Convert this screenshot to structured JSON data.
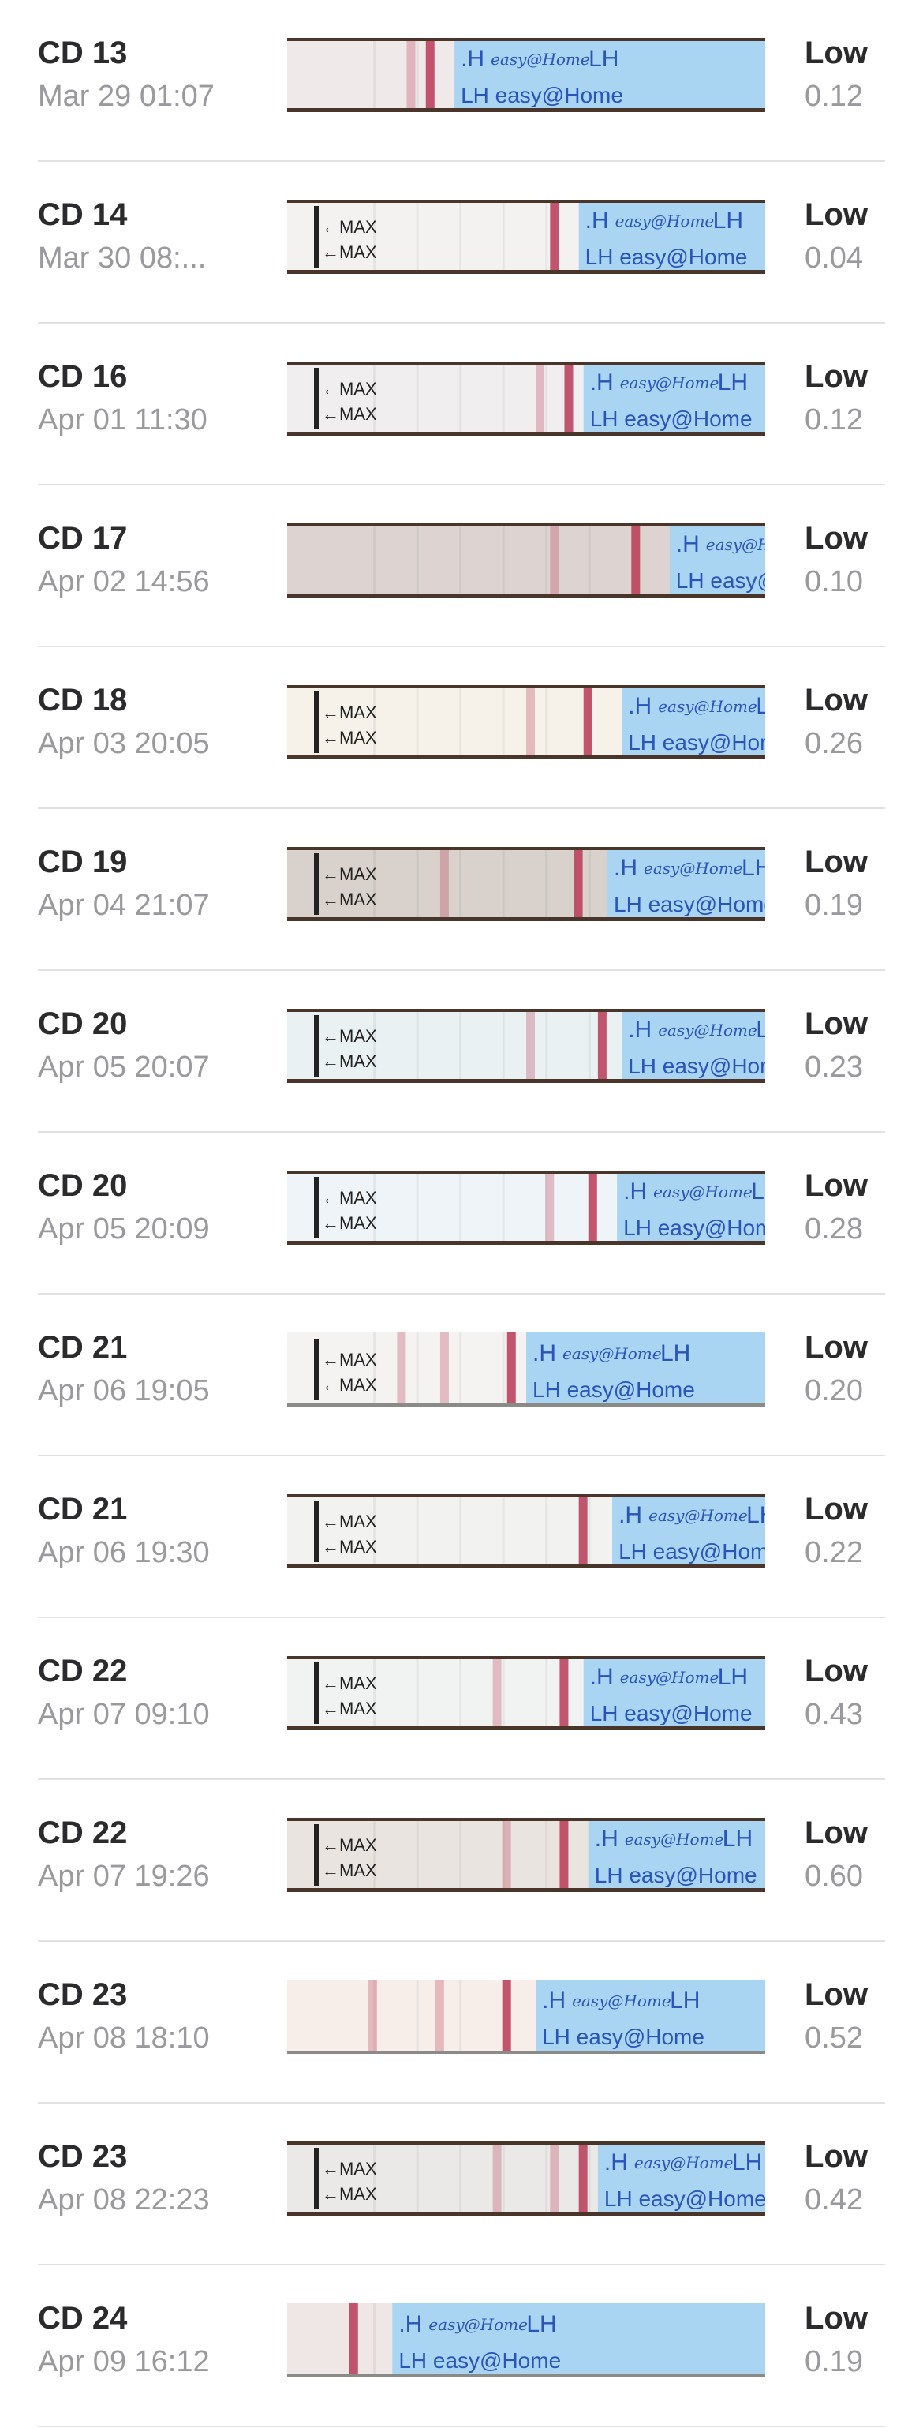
{
  "brand_text": "easy@Home",
  "lh_text": "LH",
  "max_text": "MAX",
  "colors": {
    "strip_blue": "#a9d4f2",
    "strip_text": "#2a55b8",
    "test_line": "#b93a56",
    "tape_brown": "#4a352a",
    "label": "#2b2b2d",
    "secondary": "#9a9a9e",
    "divider": "#e1e1e4"
  },
  "entries": [
    {
      "cd": "CD 13",
      "date": "Mar 29 01:07",
      "status": "Low",
      "value": "0.12",
      "strip": {
        "bg": "#efe9ea",
        "lines": [
          0.25,
          0.29
        ],
        "blue_start": 0.35,
        "max": false,
        "frame": true
      }
    },
    {
      "cd": "CD 14",
      "date": "Mar 30 08:...",
      "status": "Low",
      "value": "0.04",
      "strip": {
        "bg": "#f4f2f1",
        "lines": [
          0.55
        ],
        "blue_start": 0.61,
        "max": true,
        "frame": true
      }
    },
    {
      "cd": "CD 16",
      "date": "Apr 01 11:30",
      "status": "Low",
      "value": "0.12",
      "strip": {
        "bg": "#f1eeef",
        "lines": [
          0.52,
          0.58
        ],
        "blue_start": 0.62,
        "max": true,
        "frame": true
      }
    },
    {
      "cd": "CD 17",
      "date": "Apr 02 14:56",
      "status": "Low",
      "value": "0.10",
      "strip": {
        "bg": "#ddd4d1",
        "lines": [
          0.55,
          0.72
        ],
        "blue_start": 0.8,
        "max": false,
        "frame": true
      }
    },
    {
      "cd": "CD 18",
      "date": "Apr 03 20:05",
      "status": "Low",
      "value": "0.26",
      "strip": {
        "bg": "#f6f2ea",
        "lines": [
          0.5,
          0.62
        ],
        "blue_start": 0.7,
        "max": true,
        "frame": true
      }
    },
    {
      "cd": "CD 19",
      "date": "Apr 04 21:07",
      "status": "Low",
      "value": "0.19",
      "strip": {
        "bg": "#d9d2cc",
        "lines": [
          0.32,
          0.6
        ],
        "blue_start": 0.67,
        "max": true,
        "frame": true
      }
    },
    {
      "cd": "CD 20",
      "date": "Apr 05 20:07",
      "status": "Low",
      "value": "0.23",
      "strip": {
        "bg": "#e9f1f3",
        "lines": [
          0.5,
          0.65
        ],
        "blue_start": 0.7,
        "max": true,
        "frame": true
      }
    },
    {
      "cd": "CD 20",
      "date": "Apr 05 20:09",
      "status": "Low",
      "value": "0.28",
      "strip": {
        "bg": "#eef4f7",
        "lines": [
          0.54,
          0.63
        ],
        "blue_start": 0.69,
        "max": true,
        "frame": true
      }
    },
    {
      "cd": "CD 21",
      "date": "Apr 06 19:05",
      "status": "Low",
      "value": "0.20",
      "strip": {
        "bg": "#f5f2f2",
        "lines": [
          0.23,
          0.32,
          0.46
        ],
        "blue_start": 0.5,
        "max": true,
        "frame": false
      }
    },
    {
      "cd": "CD 21",
      "date": "Apr 06 19:30",
      "status": "Low",
      "value": "0.22",
      "strip": {
        "bg": "#f2f2f1",
        "lines": [
          0.61
        ],
        "blue_start": 0.68,
        "max": true,
        "frame": true
      }
    },
    {
      "cd": "CD 22",
      "date": "Apr 07 09:10",
      "status": "Low",
      "value": "0.43",
      "strip": {
        "bg": "#f1f3f3",
        "lines": [
          0.43,
          0.57
        ],
        "blue_start": 0.62,
        "max": true,
        "frame": true
      }
    },
    {
      "cd": "CD 22",
      "date": "Apr 07 19:26",
      "status": "Low",
      "value": "0.60",
      "strip": {
        "bg": "#e9e4df",
        "lines": [
          0.45,
          0.57
        ],
        "blue_start": 0.63,
        "max": true,
        "frame": true
      }
    },
    {
      "cd": "CD 23",
      "date": "Apr 08 18:10",
      "status": "Low",
      "value": "0.52",
      "strip": {
        "bg": "#f7eeea",
        "lines": [
          0.17,
          0.31,
          0.45
        ],
        "blue_start": 0.52,
        "max": false,
        "frame": false
      }
    },
    {
      "cd": "CD 23",
      "date": "Apr 08 22:23",
      "status": "Low",
      "value": "0.42",
      "strip": {
        "bg": "#ebe9e8",
        "lines": [
          0.43,
          0.55,
          0.61
        ],
        "blue_start": 0.65,
        "max": true,
        "frame": true
      }
    },
    {
      "cd": "CD 24",
      "date": "Apr 09 16:12",
      "status": "Low",
      "value": "0.19",
      "strip": {
        "bg": "#efe6e6",
        "lines": [
          0.13
        ],
        "blue_start": 0.22,
        "max": false,
        "frame": false
      }
    }
  ]
}
